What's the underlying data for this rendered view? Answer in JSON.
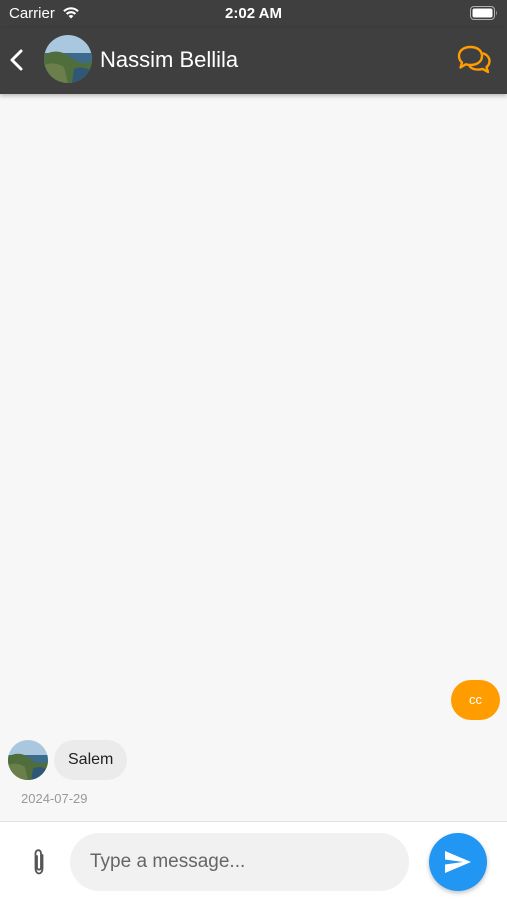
{
  "status_bar": {
    "carrier": "Carrier",
    "time": "2:02 AM"
  },
  "header": {
    "title": "Nassim Bellila",
    "back_icon": "chevron-left-icon",
    "action_icon": "chat-bubbles-icon"
  },
  "messages": [
    {
      "direction": "sent",
      "text": "cc"
    },
    {
      "direction": "received",
      "text": "Salem",
      "date": "2024-07-29"
    }
  ],
  "composer": {
    "placeholder": "Type a message...",
    "value": "",
    "attach_icon": "paperclip-icon",
    "send_icon": "send-icon"
  },
  "colors": {
    "nav_background": "#3f3f3f",
    "accent_orange": "#ff9c00",
    "send_blue": "#2196f3",
    "chat_background": "#f7f7f7"
  }
}
